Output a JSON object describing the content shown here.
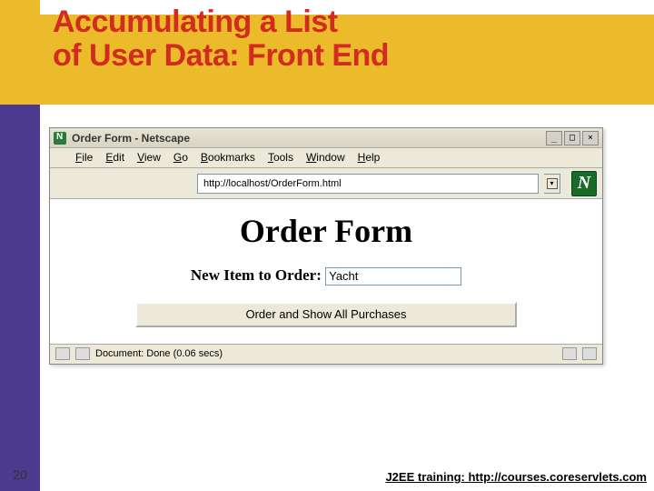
{
  "slide": {
    "title_line1": "Accumulating a List",
    "title_line2": "of User Data: Front End",
    "page_number": "20",
    "footer": "J2EE training: http://courses.coreservlets.com"
  },
  "browser": {
    "window_title": "Order Form - Netscape",
    "menu": {
      "file": "File",
      "edit": "Edit",
      "view": "View",
      "go": "Go",
      "bookmarks": "Bookmarks",
      "tools": "Tools",
      "window": "Window",
      "help": "Help"
    },
    "url": "http://localhost/OrderForm.html",
    "page_heading": "Order Form",
    "order_label": "New Item to Order:",
    "order_value": "Yacht",
    "submit_label": "Order and Show All Purchases",
    "status": "Document: Done (0.06 secs)"
  }
}
